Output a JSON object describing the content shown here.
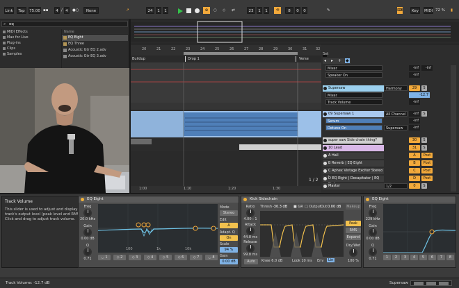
{
  "transport": {
    "link": "Link",
    "tap": "Tap",
    "tempo": "75.00",
    "sig_num": "4",
    "sig_den": "4",
    "quant": "None",
    "pos_bar": "24",
    "pos_beat": "1",
    "pos_sixteenth": "1",
    "loop_start_bar": "23",
    "loop_start_beat": "1",
    "loop_start_sixteenth": "1",
    "loop_len_bar": "8",
    "loop_len_beat": "0",
    "loop_len_sixteenth": "0",
    "key": "Key",
    "midi": "MIDI",
    "cpu": "72 %"
  },
  "browser": {
    "search_value": "eq",
    "categories": [
      "MIDI Effects",
      "Max for Live",
      "Plug-ins",
      "Clips",
      "Samples"
    ],
    "name_header": "Name",
    "items": [
      {
        "label": "EQ Eight",
        "selected": true
      },
      {
        "label": "EQ Three",
        "selected": false
      },
      {
        "label": "Acoustic Gtr EQ 2.adv",
        "selected": false
      },
      {
        "label": "Acoustic Gtr EQ 3.adv",
        "selected": false
      }
    ]
  },
  "arrangement": {
    "ruler_ticks": [
      "20",
      "21",
      "22",
      "23",
      "24",
      "25",
      "26",
      "27",
      "28",
      "29",
      "30",
      "31",
      "32"
    ],
    "locators": [
      "Buildup",
      "Drop 1",
      "Verse"
    ],
    "footer_times": [
      "1:00",
      "1:10",
      "1:20",
      "1:30"
    ],
    "page": "1 / 2"
  },
  "mixer": {
    "set_label": "Set",
    "rows": [
      {
        "name": "",
        "routing": [
          "Mixer",
          "Speaker On"
        ],
        "vals": [
          "-inf",
          "-inf",
          "-inf"
        ]
      },
      {
        "name": "Supersaw",
        "routing": [
          "Mixer",
          "Track Volume"
        ],
        "group": "Harmony",
        "vals": [
          "29",
          "-12.7",
          "-inf"
        ],
        "btn": "S"
      },
      {
        "name": "09 Supersaw 1",
        "routing": [
          "Serum",
          "Detune On"
        ],
        "group": "All Channel",
        "vals": [
          "-inf",
          "-inf",
          "-inf"
        ],
        "btn": "S",
        "mode": "Supersaw"
      },
      {
        "name": "super saw Side chain thing?",
        "routing": [],
        "vals": [
          "30"
        ],
        "btn": "S"
      },
      {
        "name": "10 Lead",
        "routing": [],
        "vals": [
          "31"
        ],
        "btn": "S"
      }
    ],
    "returns": [
      {
        "letter": "A",
        "name": "A Hall",
        "btn": "A",
        "post": "Post"
      },
      {
        "letter": "B",
        "name": "B Reverb | EQ Eight",
        "btn": "B",
        "post": "Post"
      },
      {
        "letter": "C",
        "name": "C Aphex Vintage Exciter Stereo |",
        "btn": "C",
        "post": "Post"
      },
      {
        "letter": "D",
        "name": "D EQ Eight | Decapitator | EQ Eigh",
        "btn": "D",
        "post": "Post"
      }
    ],
    "master": {
      "name": "Master",
      "vals": [
        "1/2",
        "0"
      ],
      "btn": "S"
    }
  },
  "info": {
    "title": "Track Volume",
    "text": "This slider is used to adjust and display the track's output level (peak level and RMS). Click and drag to adjust track volume."
  },
  "devices": [
    {
      "title": "EQ Eight",
      "freq_label": "Freq",
      "freq_value": "20.0 kHz",
      "gain_label": "Gain",
      "gain_value": "0.00 dB",
      "q_label": "Q",
      "q_value": "0.71",
      "mode_label": "Mode",
      "mode_value": "Stereo",
      "edit_label": "Edit",
      "edit_value": "A",
      "adapt_label": "Adapt. Q",
      "adapt_value": "On",
      "scale_label": "Scale",
      "scale_value": "94 %",
      "gain2_label": "Gain",
      "gain2_value": "0.00 dB",
      "freq_ticks": [
        "100",
        "1k",
        "10k"
      ]
    },
    {
      "title": "Kick Sidechain",
      "ratio_label": "Ratio",
      "ratio_value": "4.00 : 1",
      "attack_label": "Attack",
      "attack_value": "44.8 ms",
      "release_label": "Release",
      "release_value": "99.8 ms",
      "auto": "Auto",
      "thresh_label": "Thresh",
      "thresh_value": "-30.3 dB",
      "gr_label": "GR",
      "output_label": "Output",
      "out_label": "Out",
      "out_value": "0.00 dB",
      "makeup": "Makeup",
      "knee_label": "Knee",
      "knee_value": "6.0 dB",
      "look_label": "Look",
      "look_value": "10 ms",
      "env_label": "Env",
      "env_value": "Lin",
      "peak": "Peak",
      "rms": "RMS",
      "expand": "Expand",
      "drywet_label": "Dry/Wet",
      "drywet_value": "100 %"
    },
    {
      "title": "EQ Eight",
      "freq_label": "Freq",
      "freq_value": "229 kHz",
      "gain_label": "Gain",
      "gain_value": "0.00 dB",
      "q_label": "Q",
      "q_value": "0.71"
    }
  ],
  "statusbar": {
    "text": "Track Volume: -12.7 dB",
    "track": "Supersaw"
  },
  "colors": {
    "accent_orange": "#f2a93b",
    "accent_yellow": "#f2c14e",
    "clip_blue": "#7fb2e5",
    "track_blue": "#a9c9ef"
  }
}
